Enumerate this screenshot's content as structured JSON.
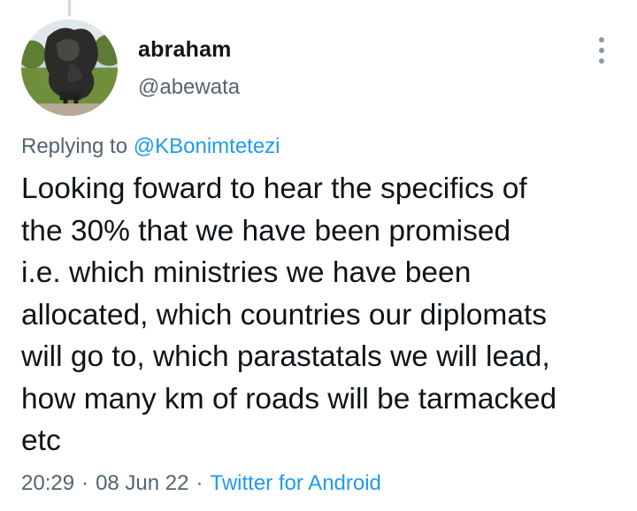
{
  "author": {
    "display_name": "abraham",
    "handle": "@abewata"
  },
  "reply": {
    "prefix": "Replying to",
    "mention": "@KBonimtetezi"
  },
  "tweet": {
    "text": "Looking foward to hear the specifics of\nthe 30% that we have been promised\ni.e. which ministries we have been\nallocated, which countries our diplomats\nwill go to, which parastatals we will lead,\nhow many km of roads will be tarmacked\netc"
  },
  "meta": {
    "time": "20:29",
    "separator": "·",
    "date": "08 Jun 22",
    "source": "Twitter for Android"
  },
  "icons": {
    "more": "more-vertical-icon"
  },
  "colors": {
    "link": "#1d9bf0",
    "secondary_text": "#536471",
    "primary_text": "#0f1419",
    "thread_line": "#cfd9de"
  }
}
